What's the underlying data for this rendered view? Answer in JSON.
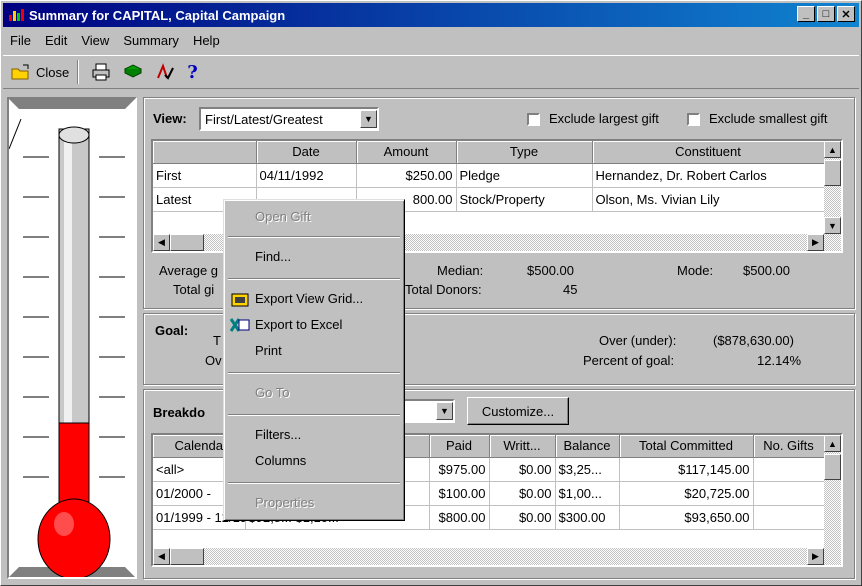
{
  "window": {
    "title": "Summary for CAPITAL, Capital Campaign"
  },
  "menu": [
    "File",
    "Edit",
    "View",
    "Summary",
    "Help"
  ],
  "toolbar": {
    "close_label": "Close"
  },
  "view": {
    "label": "View:",
    "selected": "First/Latest/Greatest",
    "exclude_largest": "Exclude largest gift",
    "exclude_smallest": "Exclude smallest gift"
  },
  "gifts_grid": {
    "columns": [
      "",
      "Date",
      "Amount",
      "Type",
      "Constituent"
    ],
    "rows": [
      [
        "First",
        "04/11/1992",
        "$250.00",
        "Pledge",
        "Hernandez, Dr. Robert Carlos"
      ],
      [
        "Latest",
        "",
        "800.00",
        "Stock/Property",
        "Olson, Ms. Vivian Lily"
      ]
    ]
  },
  "stats": {
    "average_label": "Average g",
    "total_label": "Total gi",
    "median_label": "Median:",
    "median_value": "$500.00",
    "mode_label": "Mode:",
    "mode_value": "$500.00",
    "donors_label": "Total Donors:",
    "donors_value": "45"
  },
  "goal": {
    "label": "Goal:",
    "t_label": "T",
    "ov_label": "Ov",
    "over_under_label": "Over (under):",
    "over_under_value": "($878,630.00)",
    "percent_label": "Percent of goal:",
    "percent_value": "12.14%"
  },
  "breakdown": {
    "label": "Breakdo",
    "customize_label": "Customize...",
    "columns": [
      "Calenda",
      "d",
      "Paid",
      "Writt...",
      "Balance",
      "Total Committed",
      "No. Gifts"
    ],
    "rows": [
      [
        "<all>",
        "..",
        "$975.00",
        "$0.00",
        "$3,25...",
        "$117,145.00",
        ""
      ],
      [
        "01/2000 -",
        "..",
        "$100.00",
        "$0.00",
        "$1,00...",
        "$20,725.00",
        ""
      ],
      [
        "01/1999 - 12/1999",
        "$92,8...  $1,10...",
        "$800.00",
        "$0.00",
        "$300.00",
        "$93,650.00",
        ""
      ]
    ]
  },
  "context_menu": {
    "items": [
      {
        "label": "Open Gift",
        "enabled": false
      },
      {
        "label": "Find...",
        "enabled": true
      },
      {
        "label": "Export View Grid...",
        "enabled": true
      },
      {
        "label": "Export to Excel",
        "enabled": true
      },
      {
        "label": "Print",
        "enabled": true
      },
      {
        "label": "Go To",
        "enabled": false
      },
      {
        "label": "Filters...",
        "enabled": true
      },
      {
        "label": "Columns",
        "enabled": true
      },
      {
        "label": "Properties",
        "enabled": false
      }
    ]
  },
  "thermometer": {
    "fill_fraction": 0.1214,
    "fill_color": "#ff0000"
  },
  "colors": {
    "title_start": "#000080",
    "title_end": "#1084d0",
    "face": "#c0c0c0"
  }
}
